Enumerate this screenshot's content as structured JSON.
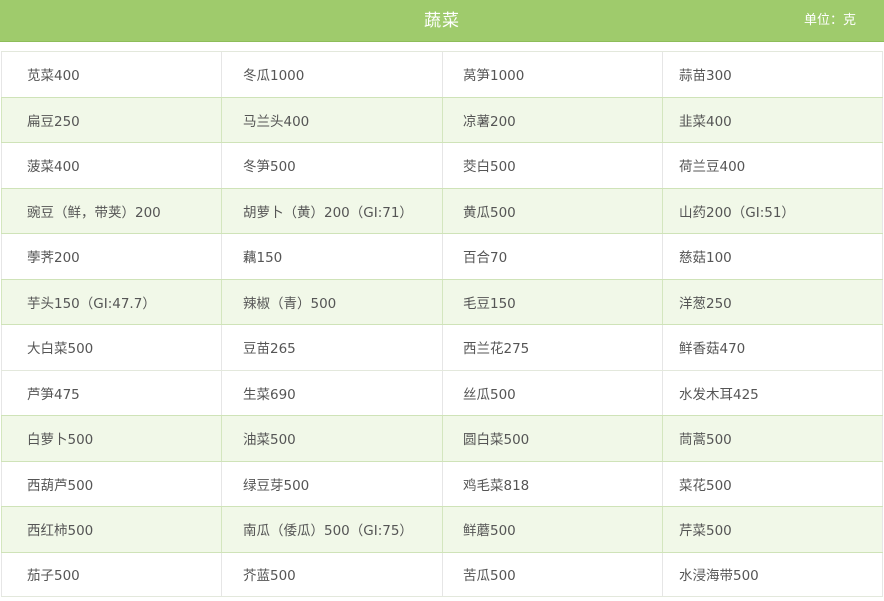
{
  "header": {
    "title": "蔬菜",
    "unit": "单位：克"
  },
  "table": {
    "rows": [
      {
        "alt": false,
        "cells": [
          "苋菜400",
          "冬瓜1000",
          "莴笋1000",
          "蒜苗300"
        ]
      },
      {
        "alt": true,
        "cells": [
          "扁豆250",
          "马兰头400",
          "凉薯200",
          "韭菜400"
        ]
      },
      {
        "alt": false,
        "cells": [
          "菠菜400",
          "冬笋500",
          "茭白500",
          "荷兰豆400"
        ]
      },
      {
        "alt": true,
        "cells": [
          "豌豆（鲜，带荚）200",
          "胡萝卜（黄）200（GI:71）",
          "黄瓜500",
          "山药200（GI:51）"
        ]
      },
      {
        "alt": false,
        "cells": [
          "荸荠200",
          "藕150",
          "百合70",
          "慈菇100"
        ]
      },
      {
        "alt": true,
        "cells": [
          "芋头150（GI:47.7）",
          "辣椒（青）500",
          "毛豆150",
          "洋葱250"
        ]
      },
      {
        "alt": false,
        "cells": [
          "大白菜500",
          "豆苗265",
          "西兰花275",
          "鲜香菇470"
        ]
      },
      {
        "alt": false,
        "cells": [
          "芦笋475",
          "生菜690",
          "丝瓜500",
          "水发木耳425"
        ]
      },
      {
        "alt": true,
        "cells": [
          "白萝卜500",
          "油菜500",
          "圆白菜500",
          "茼蒿500"
        ]
      },
      {
        "alt": false,
        "cells": [
          "西葫芦500",
          "绿豆芽500",
          "鸡毛菜818",
          "菜花500"
        ]
      },
      {
        "alt": true,
        "cells": [
          "西红柿500",
          "南瓜（倭瓜）500（GI:75）",
          "鲜蘑500",
          "芹菜500"
        ]
      },
      {
        "alt": false,
        "cells": [
          "茄子500",
          "芥蓝500",
          "苦瓜500",
          "水浸海带500"
        ]
      }
    ]
  }
}
